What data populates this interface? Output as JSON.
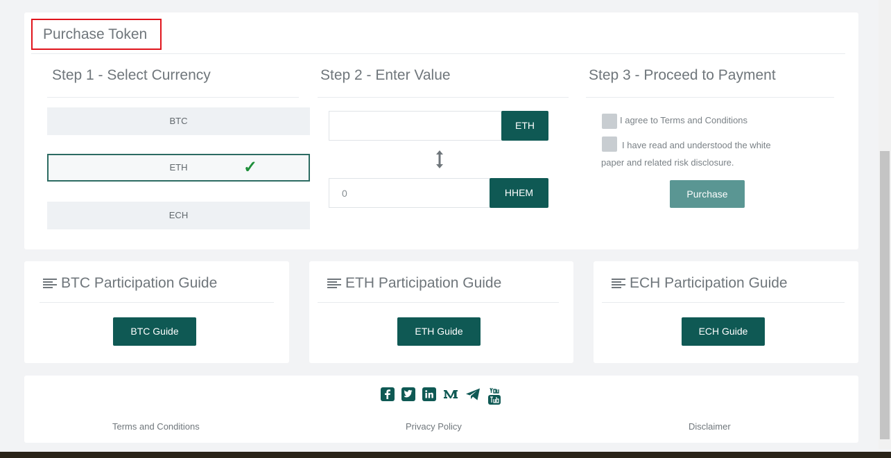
{
  "purchase": {
    "title": "Purchase Token",
    "step1": {
      "heading": "Step 1 - Select Currency",
      "options": [
        "BTC",
        "ETH",
        "ECH"
      ],
      "selected": "ETH",
      "check_glyph": "✓"
    },
    "step2": {
      "heading": "Step 2 - Enter Value",
      "pay_value": "",
      "pay_unit": "ETH",
      "receive_value": "0",
      "receive_unit": "HHEM",
      "swap_icon": "vertical-arrows-icon"
    },
    "step3": {
      "heading": "Step 3 - Proceed to Payment",
      "terms_label": "I agree to Terms and Conditions",
      "whitepaper_label_line1": "I have read and understood the white",
      "whitepaper_label_line2": "paper and related risk disclosure.",
      "terms_checked": false,
      "whitepaper_checked": false,
      "button_label": "Purchase"
    }
  },
  "guides": [
    {
      "title": "BTC Participation Guide",
      "button_label": "BTC Guide",
      "icon": "align-lines-icon"
    },
    {
      "title": "ETH Participation Guide",
      "button_label": "ETH Guide",
      "icon": "align-lines-icon"
    },
    {
      "title": "ECH Participation Guide",
      "button_label": "ECH Guide",
      "icon": "align-lines-icon"
    }
  ],
  "footer": {
    "social_icons": [
      "facebook-icon",
      "twitter-icon",
      "linkedin-icon",
      "medium-icon",
      "telegram-icon",
      "youtube-icon"
    ],
    "links": [
      "Terms and Conditions",
      "Privacy Policy",
      "Disclaimer"
    ]
  },
  "colors": {
    "accent": "#0f5954",
    "purchase_button": "#5a9693",
    "highlight_border": "#e0141c",
    "check": "#1e8f3a"
  }
}
